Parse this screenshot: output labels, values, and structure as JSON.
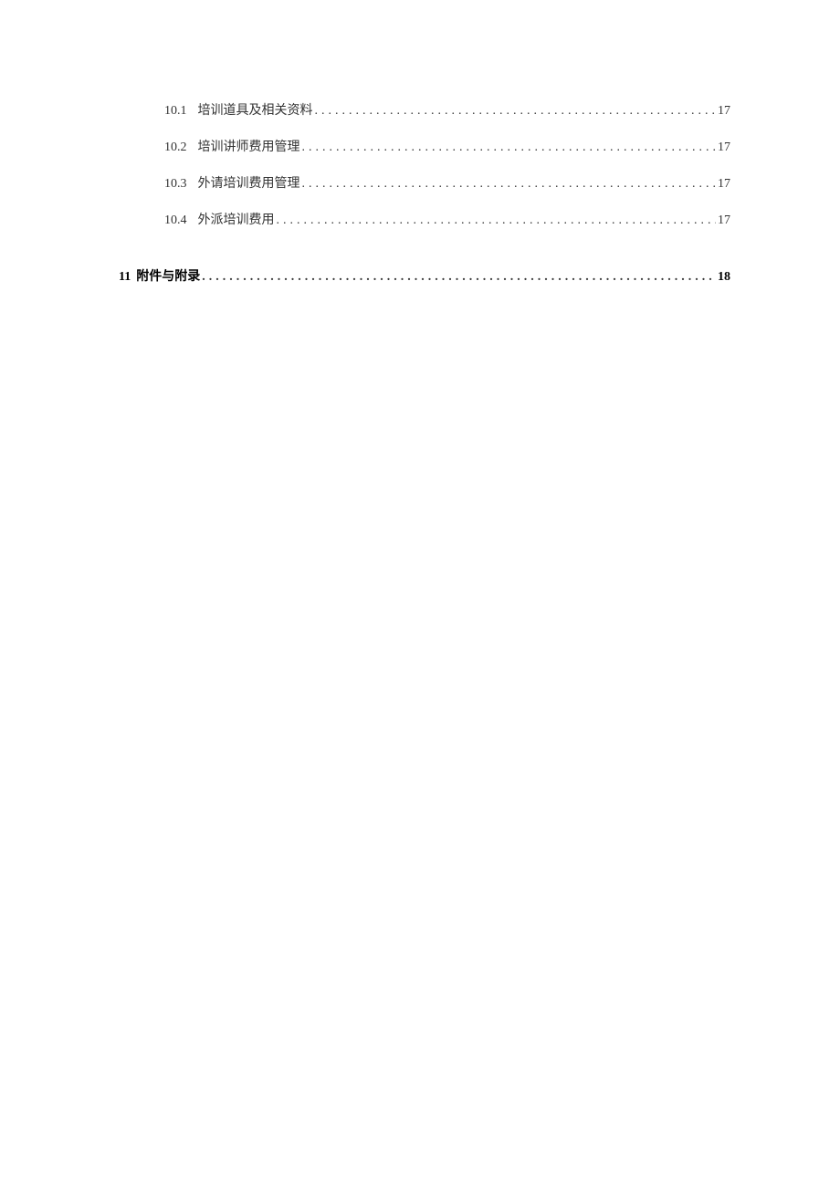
{
  "toc": {
    "sub_items": [
      {
        "number": "10.1",
        "title": "培训道具及相关资料",
        "page": "17"
      },
      {
        "number": "10.2",
        "title": "培训讲师费用管理",
        "page": "17"
      },
      {
        "number": "10.3",
        "title": "外请培训费用管理",
        "page": "17"
      },
      {
        "number": "10.4",
        "title": "外派培训费用",
        "page": "17"
      }
    ],
    "main_item": {
      "number": "11",
      "title": "附件与附录",
      "page": "18"
    }
  }
}
